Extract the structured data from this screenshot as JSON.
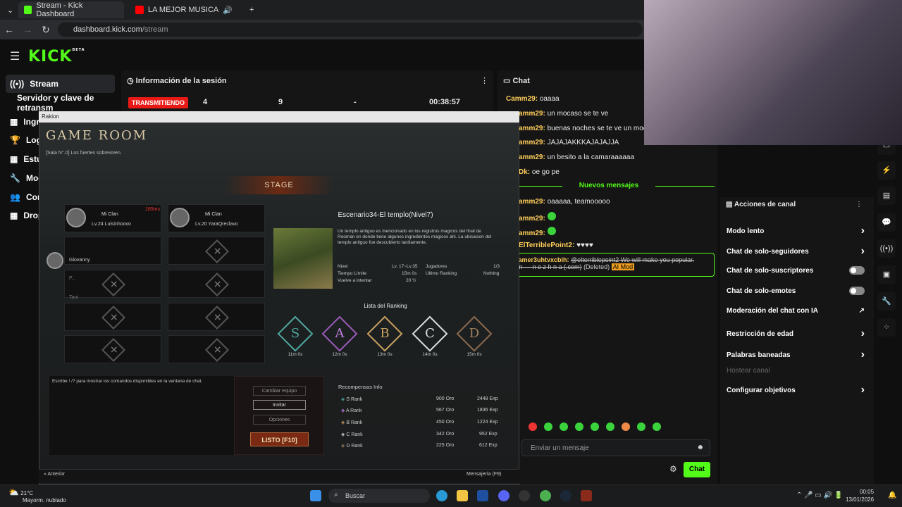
{
  "browser": {
    "tabs": [
      {
        "label": "Stream - Kick Dashboard"
      },
      {
        "label": "LA MEJOR MUSICA para ST"
      }
    ],
    "url_host": "dashboard.kick.com",
    "url_path": "/stream"
  },
  "kick": {
    "logo": "KICK",
    "beta": "BETA",
    "sidebar": [
      {
        "label": "Stream",
        "icon": "stream-icon"
      },
      {
        "label": "Servidor y clave de retransm"
      },
      {
        "label": "Ingr"
      },
      {
        "label": "Logr"
      },
      {
        "label": "Estu"
      },
      {
        "label": "Mod"
      },
      {
        "label": "Com"
      },
      {
        "label": "Drop"
      }
    ],
    "session": {
      "title": "Información de la sesión",
      "status": "TRANSMITIENDO",
      "v1": "4",
      "v2": "9",
      "v3": "-",
      "time": "00:38:57"
    },
    "chat": {
      "title": "Chat",
      "lines": [
        {
          "user": "Camm29:",
          "text": "oaaaa"
        },
        {
          "user": "amm29:",
          "text": "un mocaso se te ve"
        },
        {
          "user": "amm29:",
          "text": "buenas noches se te ve un mocaso"
        },
        {
          "user": "amm29:",
          "text": "JAJAJAKKKAJAJAJJA"
        },
        {
          "user": "amm29:",
          "text": "un besito a la camaraaaaaa"
        },
        {
          "user": "Dk:",
          "text": "oe go pe"
        }
      ],
      "new_messages": "Nuevos mensajes",
      "lines2": [
        {
          "user": "amm29:",
          "text": "oaaaaa, teamooooo"
        },
        {
          "user": "amm29:",
          "text": ""
        },
        {
          "user": "amm29:",
          "text": ""
        },
        {
          "user": "ElTerriblePoint2:",
          "text": "♥♥♥♥"
        }
      ],
      "deleted_user": "ntamer3uhtvxcbih:",
      "deleted_text": "@elterriblepoint2 We will make you popular.",
      "deleted_text2": "e in — n e z h n a (.com)",
      "deleted_tag": "(Deleted)",
      "aimod": "AI Mod",
      "input_placeholder": "Enviar un mensaje",
      "send": "Chat"
    },
    "actions": {
      "title": "Acciones de canal",
      "items": [
        {
          "label": "Modo lento",
          "ctl": "›"
        },
        {
          "label": "Chat de solo-seguidores",
          "ctl": "›"
        },
        {
          "label": "Chat de solo-suscriptores",
          "ctl": "toggle"
        },
        {
          "label": "Chat de solo-emotes",
          "ctl": "toggle"
        },
        {
          "label": "Moderación del chat con IA",
          "ctl": "↗"
        },
        {
          "label": "Restricción de edad",
          "ctl": "›"
        },
        {
          "label": "Palabras baneadas",
          "ctl": "›"
        },
        {
          "label": "Hostear canal",
          "ctl": ""
        },
        {
          "label": "Configurar objetivos",
          "ctl": "›"
        }
      ]
    }
  },
  "game": {
    "window_title": "Rakion",
    "title": "GAME ROOM",
    "subtitle": "[Sala N°.0] Los fuertes sobreviven.",
    "stage_label": "STAGE",
    "players": [
      {
        "clan": "Mi Clan",
        "info": "Lv.24 Luisinhoovo",
        "ping": "185ms"
      },
      {
        "clan": "Mi Clan",
        "info": "Lv.20 YaraQreclavo"
      }
    ],
    "spectators": [
      "Giovanny",
      "P...",
      "Tani"
    ],
    "stage": {
      "name": "Escenario34-El templo(Nivel7)",
      "desc": "Un templo antiguo es mencionado en los registros magicos del final de Rooman en donde tiene algunos ingredientes magicos ahi. La ubicacion del templo antiguo fue descubierto tardiamente.",
      "nivel_k": "Nivel",
      "nivel_v": "Lv. 17~Lv.35",
      "jug_k": "Jugadores",
      "jug_v": "1/3",
      "tiempo_k": "Tiempo Límite",
      "tiempo_v": "15m 0s",
      "ult_k": "Ultimo Ranking",
      "ult_v": "Nothing",
      "vuelve_k": "Vuelve a intentar",
      "vuelve_v": "20 ½"
    },
    "rank_header": "Lista del Ranking",
    "ranks": [
      {
        "l": "S",
        "t": "11m 0s",
        "c": "#4fa8a0"
      },
      {
        "l": "A",
        "t": "12m 0s",
        "c": "#9a5ab8"
      },
      {
        "l": "B",
        "t": "13m 0s",
        "c": "#c8a060"
      },
      {
        "l": "C",
        "t": "14m 0s",
        "c": "#dddddd"
      },
      {
        "l": "D",
        "t": "15m 0s",
        "c": "#8a6a50"
      }
    ],
    "chat_hint": "Escribe ! /? para mostrar los comandos disponibles en la ventana de chat.",
    "buttons": {
      "cambiar": "Cambiar equipo",
      "invitar": "Invitar",
      "opciones": "Opciones",
      "listo": "LISTO [F10]"
    },
    "rewards": {
      "title": "Recompensas Info",
      "rows": [
        {
          "r": "S Rank",
          "o": "900 Oro",
          "e": "2448 Exp"
        },
        {
          "r": "A Rank",
          "o": "567 Oro",
          "e": "1836 Exp"
        },
        {
          "r": "B Rank",
          "o": "450 Oro",
          "e": "1224 Exp"
        },
        {
          "r": "C Rank",
          "o": "342 Oro",
          "e": "952 Exp"
        },
        {
          "r": "D Rank",
          "o": "225 Oro",
          "e": "612 Exp"
        }
      ]
    },
    "bottom": {
      "prev": "Anterior",
      "msg": "Mensajería (F9)"
    }
  },
  "taskbar": {
    "temp": "21°C",
    "weather": "Mayorm. nublado",
    "search": "Buscar",
    "time": "00:05",
    "date": "13/01/2026"
  }
}
